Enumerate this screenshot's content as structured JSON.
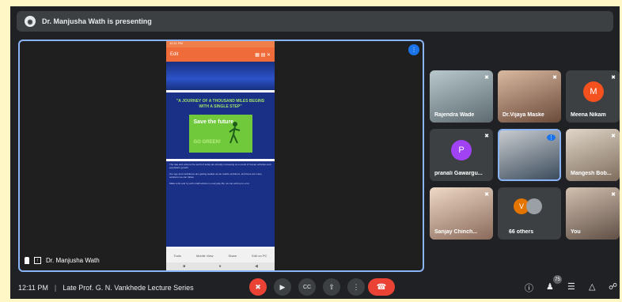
{
  "presenting_banner": {
    "text": "Dr. Manjusha Wath is presenting"
  },
  "stage": {
    "presenter_name": "Dr. Manjusha Wath"
  },
  "shared_screen": {
    "status_time": "12:11 PM",
    "toolbar_title": "Edit",
    "quote": "\"A JOURNEY OF A THOUSAND MILES BEGINS WITH A SINGLE STEP\"",
    "poster_title": "Save the future",
    "poster_sub": "GO GREEN!",
    "paragraphs": [
      "The rate and volume the world of today are sharply increasing as a result of human activities and population growth.",
      "Our ego and confidence are getting weaker as we realize problems, and there are many solutions we can follow.",
      "Make a list and try with small actions in everyday life; we can add up to a lot."
    ],
    "nav": [
      "Tools",
      "Mobile View",
      "Share",
      "Edit on PC"
    ],
    "home": [
      "■",
      "●",
      "◀"
    ]
  },
  "participants": [
    {
      "name": "Rajendra Wade",
      "type": "photo",
      "bg": "#7a8a8e"
    },
    {
      "name": "Dr.Vijaya Maske",
      "type": "photo",
      "bg": "#8a6f5a"
    },
    {
      "name": "Meena Nikam",
      "type": "avatar",
      "initial": "M",
      "color": "#f4511e"
    },
    {
      "name": "pranali Gawargu...",
      "type": "avatar",
      "initial": "P",
      "color": "#a142f4"
    },
    {
      "name": "",
      "type": "photo",
      "bg": "#5f6e7a"
    },
    {
      "name": "Mangesh Bob...",
      "type": "photo",
      "bg": "#9c8a78"
    },
    {
      "name": "Sanjay Chinch...",
      "type": "photo",
      "bg": "#b89a88"
    },
    {
      "name": "66 others",
      "type": "others",
      "initial": "V",
      "color": "#e37400"
    },
    {
      "name": "You",
      "type": "photo",
      "bg": "#8a7a6e"
    }
  ],
  "bottom_bar": {
    "time": "12:11 PM",
    "meeting_title": "Late Prof. G. N. Vankhede Lecture Series",
    "participant_count": "75"
  },
  "colors": {
    "accent": "#8ab4f8",
    "end_call": "#ea4335",
    "background": "#202124"
  }
}
